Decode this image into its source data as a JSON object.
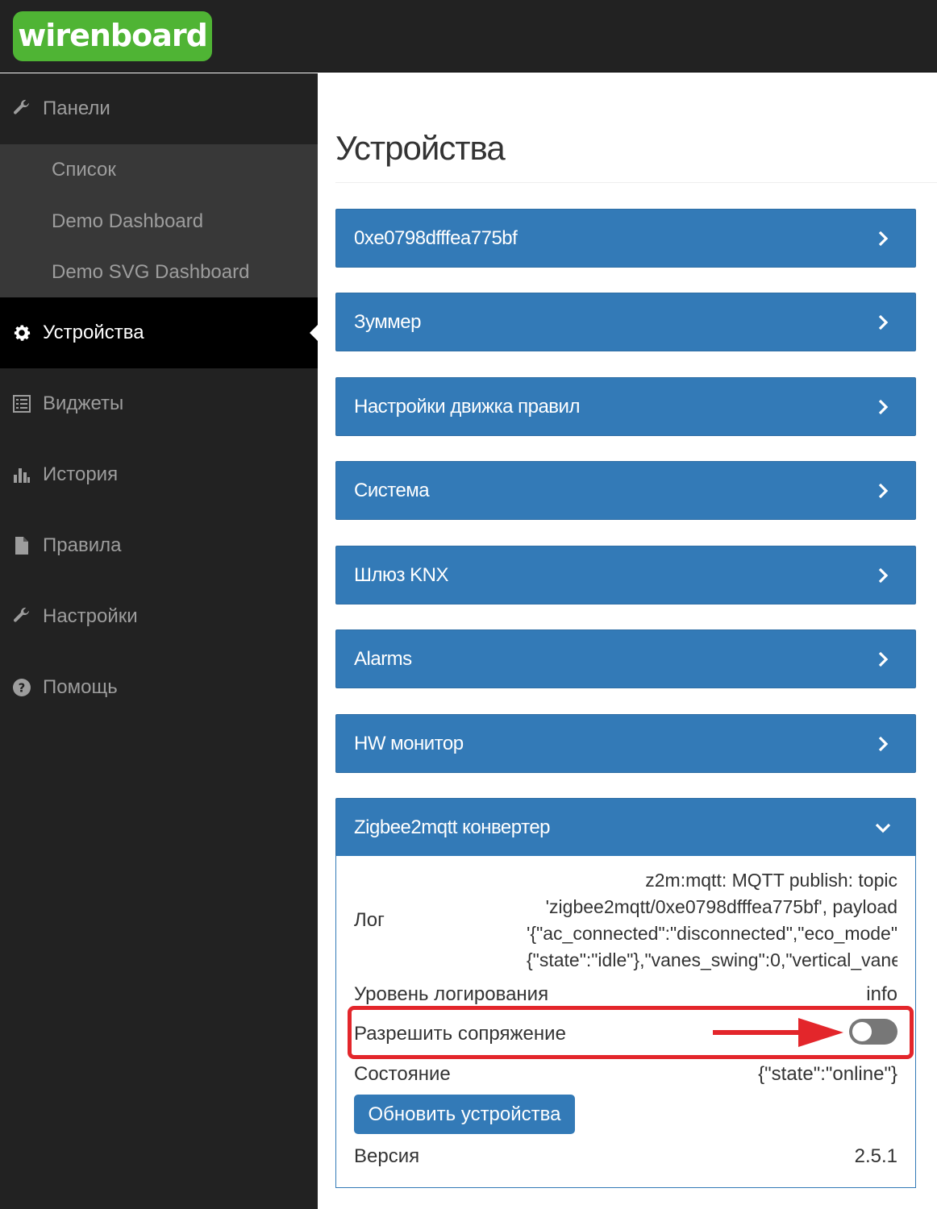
{
  "brand": {
    "logo_text": "wirenboard",
    "accent": "#4fb434"
  },
  "sidebar": {
    "items": [
      {
        "label": "Панели",
        "icon": "wrench-icon"
      },
      {
        "label": "Устройства",
        "icon": "gear-icon",
        "active": true
      },
      {
        "label": "Виджеты",
        "icon": "list-icon"
      },
      {
        "label": "История",
        "icon": "bar-chart-icon"
      },
      {
        "label": "Правила",
        "icon": "file-icon"
      },
      {
        "label": "Настройки",
        "icon": "wrench-icon"
      },
      {
        "label": "Помощь",
        "icon": "question-icon"
      }
    ],
    "submenu": [
      {
        "label": "Список"
      },
      {
        "label": "Demo Dashboard"
      },
      {
        "label": "Demo SVG Dashboard"
      }
    ]
  },
  "main": {
    "title": "Устройства",
    "devices": [
      {
        "name": "0xe0798dfffea775bf"
      },
      {
        "name": "Зуммер"
      },
      {
        "name": "Настройки движка правил"
      },
      {
        "name": "Система"
      },
      {
        "name": "Шлюз KNX"
      },
      {
        "name": "Alarms"
      },
      {
        "name": "HW монитор"
      },
      {
        "name": "Zigbee2mqtt конвертер",
        "expanded": true
      }
    ],
    "zigbee": {
      "log_label": "Лог",
      "log_lines": [
        "z2m:mqtt: MQTT publish: topic",
        "'zigbee2mqtt/0xe0798dfffea775bf', payload",
        "'{\"ac_connected\":\"disconnected\",\"eco_mode\"",
        "{\"state\":\"idle\"},\"vanes_swing\":0,\"vertical_vane"
      ],
      "log_level_label": "Уровень логирования",
      "log_level_value": "info",
      "permit_join_label": "Разрешить сопряжение",
      "permit_join_on": false,
      "state_label": "Состояние",
      "state_value": "{\"state\":\"online\"}",
      "update_button": "Обновить устройства",
      "version_label": "Версия",
      "version_value": "2.5.1"
    }
  },
  "colors": {
    "panel": "#337ab7",
    "highlight": "#e3262b",
    "sidebar": "#222222"
  }
}
